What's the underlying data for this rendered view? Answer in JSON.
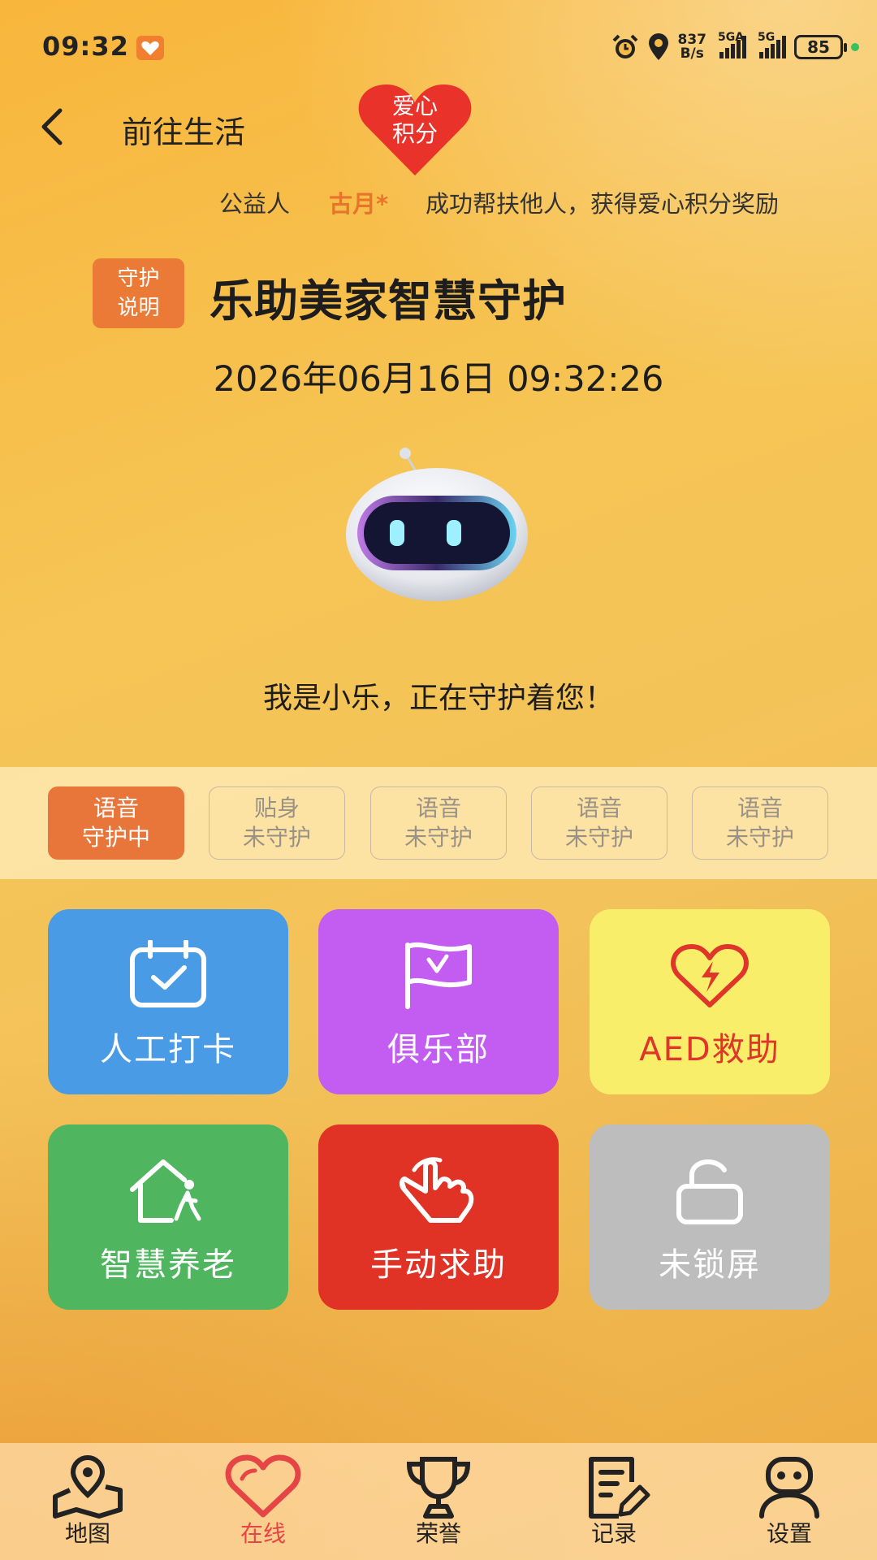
{
  "status_bar": {
    "time": "09:32",
    "speed_top": "837",
    "speed_bottom": "B/s",
    "signal1_label": "5GA",
    "signal2_label": "5G",
    "battery": "85"
  },
  "header": {
    "back_label": "前往生活",
    "badge_line1": "爱心",
    "badge_line2": "积分"
  },
  "ticker": {
    "prefix": "公益人",
    "name": "古月*",
    "message": "成功帮扶他人，获得爱心积分奖励"
  },
  "guard_info": {
    "line1": "守护",
    "line2": "说明"
  },
  "title": "乐助美家智慧守护",
  "datetime": "2026年06月16日 09:32:26",
  "greeting": "我是小乐，正在守护着您！",
  "guard_modes": [
    {
      "line1": "语音",
      "line2": "守护中",
      "active": true
    },
    {
      "line1": "贴身",
      "line2": "未守护",
      "active": false
    },
    {
      "line1": "语音",
      "line2": "未守护",
      "active": false
    },
    {
      "line1": "语音",
      "line2": "未守护",
      "active": false
    },
    {
      "line1": "语音",
      "line2": "未守护",
      "active": false
    }
  ],
  "tiles": [
    {
      "label": "人工打卡",
      "icon": "calendar-check-icon",
      "color": "#4a9be6"
    },
    {
      "label": "俱乐部",
      "icon": "flag-icon",
      "color": "#c35cf0"
    },
    {
      "label": "AED救助",
      "icon": "heart-bolt-icon",
      "color": "#f8ee6a"
    },
    {
      "label": "智慧养老",
      "icon": "home-walk-icon",
      "color": "#4fb55e"
    },
    {
      "label": "手动求助",
      "icon": "hand-pointer-icon",
      "color": "#e03225"
    },
    {
      "label": "未锁屏",
      "icon": "unlock-icon",
      "color": "#bdbdbd"
    }
  ],
  "nav": [
    {
      "label": "地图",
      "icon": "map-pin-icon"
    },
    {
      "label": "在线",
      "icon": "heart-icon",
      "active": true
    },
    {
      "label": "荣誉",
      "icon": "trophy-icon"
    },
    {
      "label": "记录",
      "icon": "note-edit-icon"
    },
    {
      "label": "设置",
      "icon": "robot-face-icon"
    }
  ],
  "colors": {
    "accent": "#ea7a35",
    "aed_text": "#e0352a",
    "nav_active": "#e54545"
  }
}
